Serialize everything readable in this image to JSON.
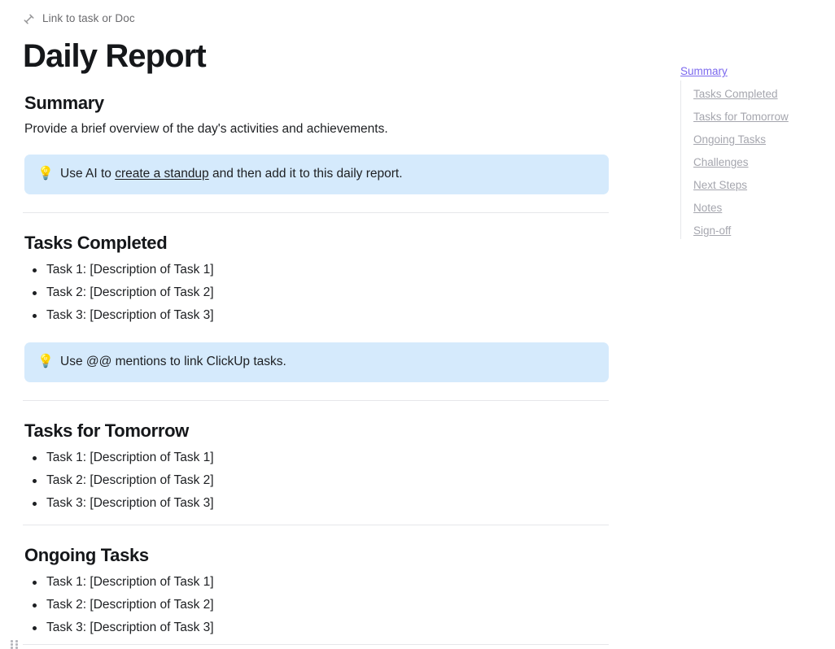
{
  "top_bar": {
    "link_label": "Link to task or Doc",
    "link_icon": "link-diagonal-icon"
  },
  "document": {
    "title": "Daily Report"
  },
  "theme": {
    "accent": "#7b68ee",
    "callout_bg": "#d5eafc",
    "divider": "#e6e7ea",
    "text": "#1d1f22",
    "muted_text": "#a5a6ae"
  },
  "sections": [
    {
      "heading": "Summary",
      "paragraph": "Provide a brief overview of the day's activities and achievements."
    },
    {
      "heading": "Tasks Completed",
      "items": [
        "Task 1: [Description of Task 1]",
        "Task 2: [Description of Task 2]",
        "Task 3: [Description of Task 3]"
      ]
    },
    {
      "heading": "Tasks for Tomorrow",
      "items": [
        "Task 1: [Description of Task 1]",
        "Task 2: [Description of Task 2]",
        "Task 3: [Description of Task 3]"
      ]
    },
    {
      "heading": "Ongoing Tasks",
      "items": [
        "Task 1: [Description of Task 1]",
        "Task 2: [Description of Task 2]",
        "Task 3: [Description of Task 3]"
      ]
    }
  ],
  "callouts": [
    {
      "icon": "lightbulb-icon",
      "icon_glyph": "💡",
      "text_before": "Use AI to ",
      "link_text": "create a standup",
      "text_after": " and then add it to this daily report."
    },
    {
      "icon": "lightbulb-icon",
      "icon_glyph": "💡",
      "text_before": "Use @@ mentions to link ClickUp tasks.",
      "link_text": "",
      "text_after": ""
    }
  ],
  "table_of_contents": {
    "items": [
      {
        "label": "Summary",
        "active": true
      },
      {
        "label": "Tasks Completed",
        "active": false
      },
      {
        "label": "Tasks for Tomorrow",
        "active": false
      },
      {
        "label": "Ongoing Tasks",
        "active": false
      },
      {
        "label": "Challenges",
        "active": false
      },
      {
        "label": "Next Steps",
        "active": false
      },
      {
        "label": "Notes",
        "active": false
      },
      {
        "label": "Sign-off",
        "active": false
      }
    ]
  },
  "bottom": {
    "drag_handle_icon": "drag-handle-icon"
  }
}
